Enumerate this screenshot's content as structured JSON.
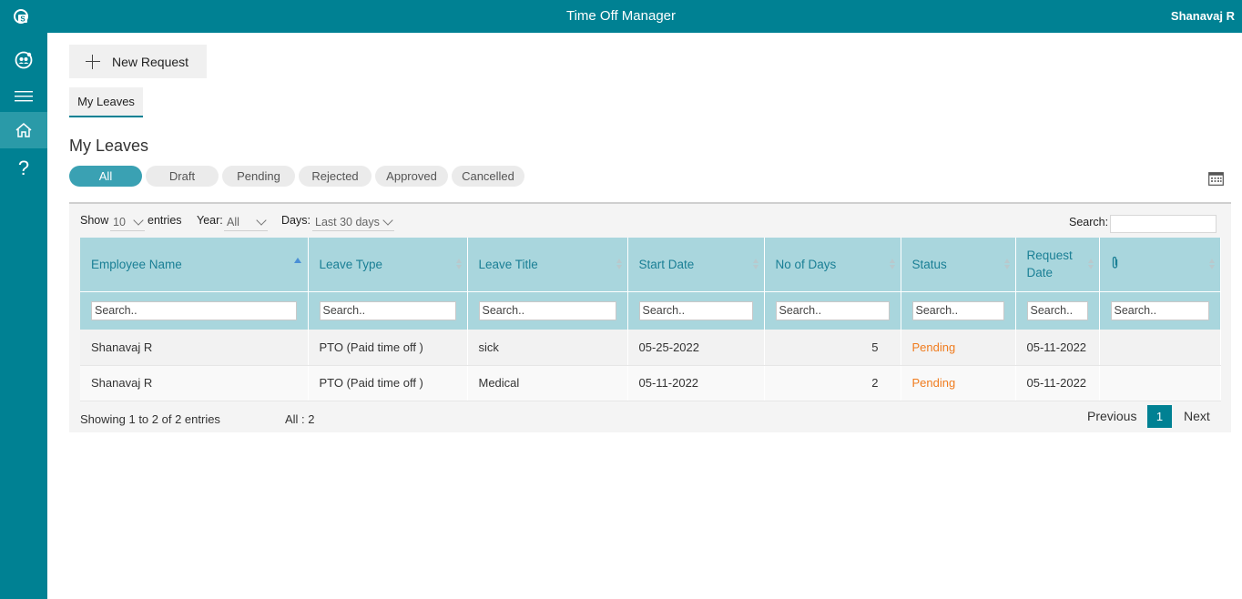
{
  "app": {
    "title": "Time Off Manager",
    "user": "Shanavaj R"
  },
  "toolbar": {
    "new_request_label": "New Request"
  },
  "tabs": [
    {
      "label": "My Leaves",
      "active": true
    }
  ],
  "section": {
    "title": "My Leaves"
  },
  "filters": [
    {
      "label": "All",
      "active": true
    },
    {
      "label": "Draft"
    },
    {
      "label": "Pending"
    },
    {
      "label": "Rejected"
    },
    {
      "label": "Approved"
    },
    {
      "label": "Cancelled"
    }
  ],
  "controls": {
    "show_label": "Show",
    "show_value": "10",
    "entries_label": "entries",
    "year_label": "Year:",
    "year_value": "All",
    "days_label": "Days:",
    "days_value": "Last 30 days",
    "search_label": "Search:"
  },
  "table": {
    "columns": [
      "Employee Name",
      "Leave Type",
      "Leave Title",
      "Start Date",
      "No of Days",
      "Status",
      "Request Date",
      "attachment-icon"
    ],
    "column_search_placeholder": "Search..",
    "rows": [
      {
        "employee": "Shanavaj R",
        "leave_type": "PTO (Paid time off )",
        "title": "sick",
        "start": "05-25-2022",
        "days": "5",
        "status": "Pending",
        "request_date": "05-11-2022"
      },
      {
        "employee": "Shanavaj R",
        "leave_type": "PTO (Paid time off )",
        "title": "Medical",
        "start": "05-11-2022",
        "days": "2",
        "status": "Pending",
        "request_date": "05-11-2022"
      }
    ]
  },
  "footer": {
    "info": "Showing 1 to 2 of 2 entries",
    "count": "All : 2",
    "previous": "Previous",
    "page": "1",
    "next": "Next"
  },
  "colors": {
    "brand": "#008193",
    "header_row": "#a9d6dd",
    "pending": "#f07c1e",
    "active_pill": "#3aa1b3"
  },
  "icons": [
    "sharepoint-logo-icon",
    "app-logo-icon",
    "menu-icon",
    "home-icon",
    "help-icon",
    "plus-icon",
    "calendar-icon",
    "attachment-icon"
  ]
}
